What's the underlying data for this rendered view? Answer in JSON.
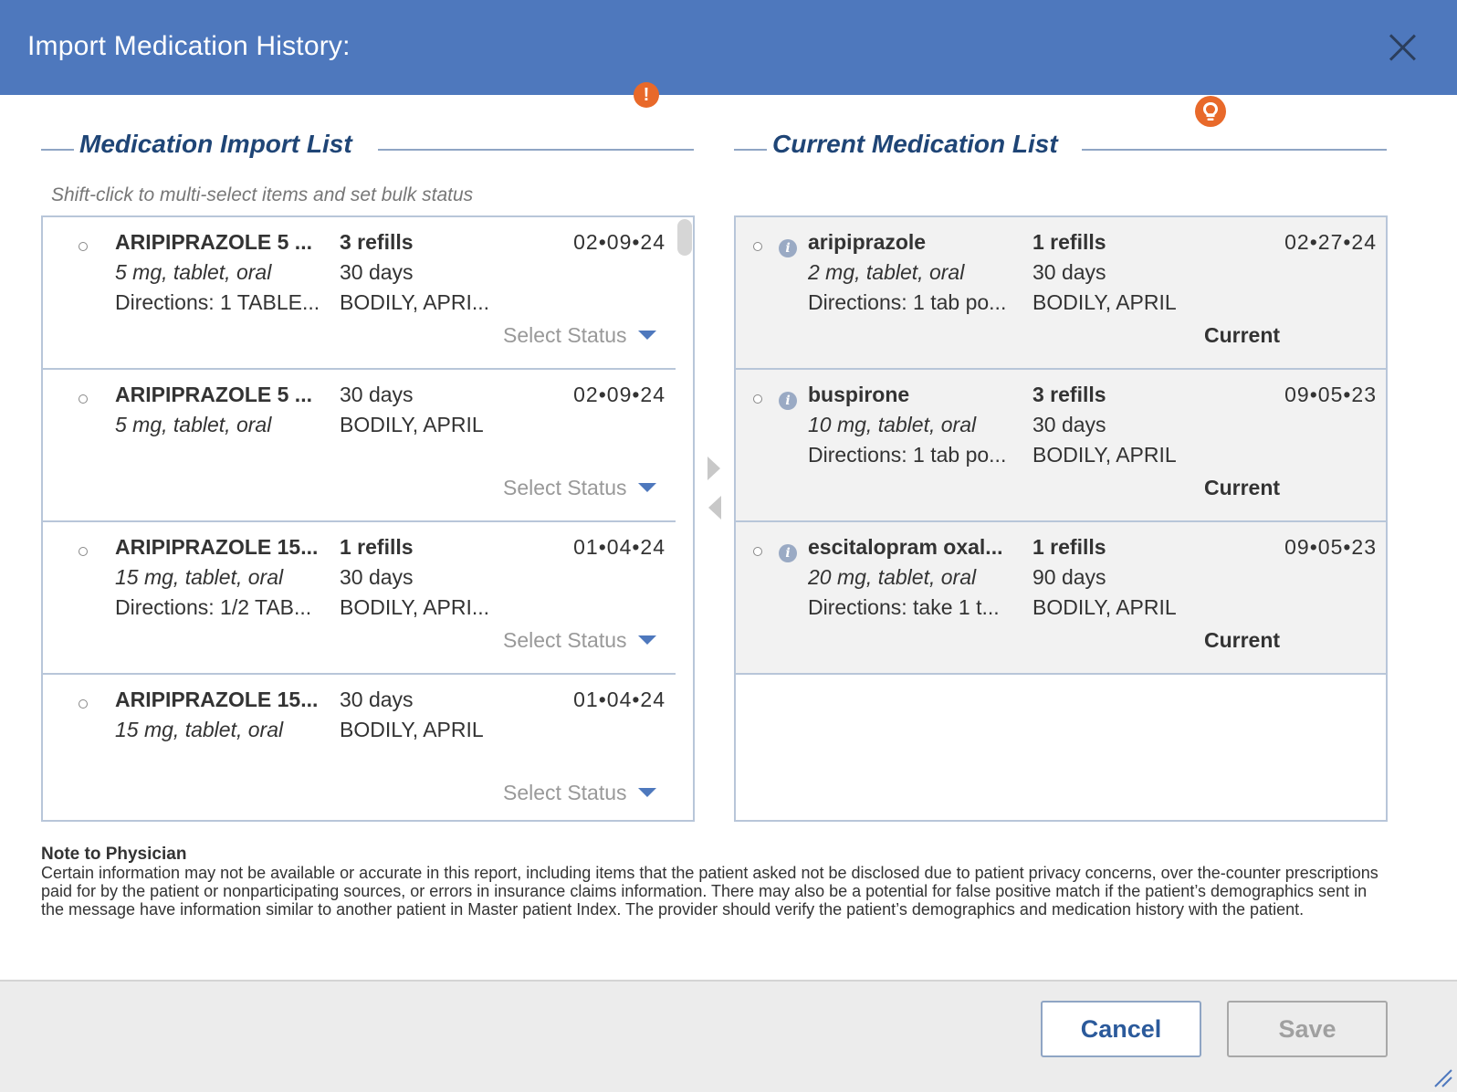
{
  "header": {
    "title": "Import Medication History:"
  },
  "import_section": {
    "title": "Medication Import List",
    "hint": "Shift-click to multi-select items and set bulk status",
    "items": [
      {
        "name": "ARIPIPRAZOLE 5 ...",
        "dose": "5 mg, tablet, oral",
        "directions": "Directions: 1 TABLE...",
        "refills": "3 refills",
        "days": "30 days",
        "prescriber": "BODILY, APRI...",
        "date": "02•09•24",
        "status": "Select Status"
      },
      {
        "name": "ARIPIPRAZOLE 5 ...",
        "dose": "5 mg, tablet, oral",
        "directions": "",
        "refills": "30 days",
        "days": "BODILY, APRIL",
        "prescriber": "",
        "date": "02•09•24",
        "status": "Select Status"
      },
      {
        "name": "ARIPIPRAZOLE 15...",
        "dose": "15 mg, tablet, oral",
        "directions": "Directions: 1/2 TAB...",
        "refills": "1 refills",
        "days": "30 days",
        "prescriber": "BODILY, APRI...",
        "date": "01•04•24",
        "status": "Select Status"
      },
      {
        "name": "ARIPIPRAZOLE 15...",
        "dose": "15 mg, tablet, oral",
        "directions": "",
        "refills": "30 days",
        "days": "BODILY, APRIL",
        "prescriber": "",
        "date": "01•04•24",
        "status": "Select Status"
      }
    ]
  },
  "current_section": {
    "title": "Current Medication List",
    "items": [
      {
        "name": "aripiprazole",
        "dose": "2 mg, tablet, oral",
        "directions": "Directions: 1 tab po...",
        "refills": "1 refills",
        "days": "30 days",
        "prescriber": "BODILY, APRIL",
        "date": "02•27•24",
        "status": "Current"
      },
      {
        "name": "buspirone",
        "dose": "10 mg, tablet, oral",
        "directions": "Directions: 1 tab po...",
        "refills": "3 refills",
        "days": "30 days",
        "prescriber": "BODILY, APRIL",
        "date": "09•05•23",
        "status": "Current"
      },
      {
        "name": "escitalopram oxal...",
        "dose": "20 mg, tablet, oral",
        "directions": "Directions: take 1 t...",
        "refills": "1 refills",
        "days": "90 days",
        "prescriber": "BODILY, APRIL",
        "date": "09•05•23",
        "status": "Current"
      }
    ]
  },
  "badges": {
    "alert_symbol": "!",
    "info_symbol": "i"
  },
  "note": {
    "title": "Note to Physician",
    "body": "Certain information may not be available or accurate in this report, including items that the patient asked not be disclosed due to patient privacy concerns, over the-counter prescriptions paid for by the patient or nonparticipating sources, or errors in insurance claims information. There may also be a potential for false positive match if the patient’s demographics sent in the message have information similar to another patient in Master patient Index. The provider should verify the patient’s demographics and medication history with the patient."
  },
  "footer": {
    "cancel_label": "Cancel",
    "save_label": "Save"
  },
  "colors": {
    "header_bg": "#4e78bd",
    "section_title": "#1f4576",
    "badge_orange": "#e8692a",
    "current_row_bg": "#f2f2f2"
  }
}
